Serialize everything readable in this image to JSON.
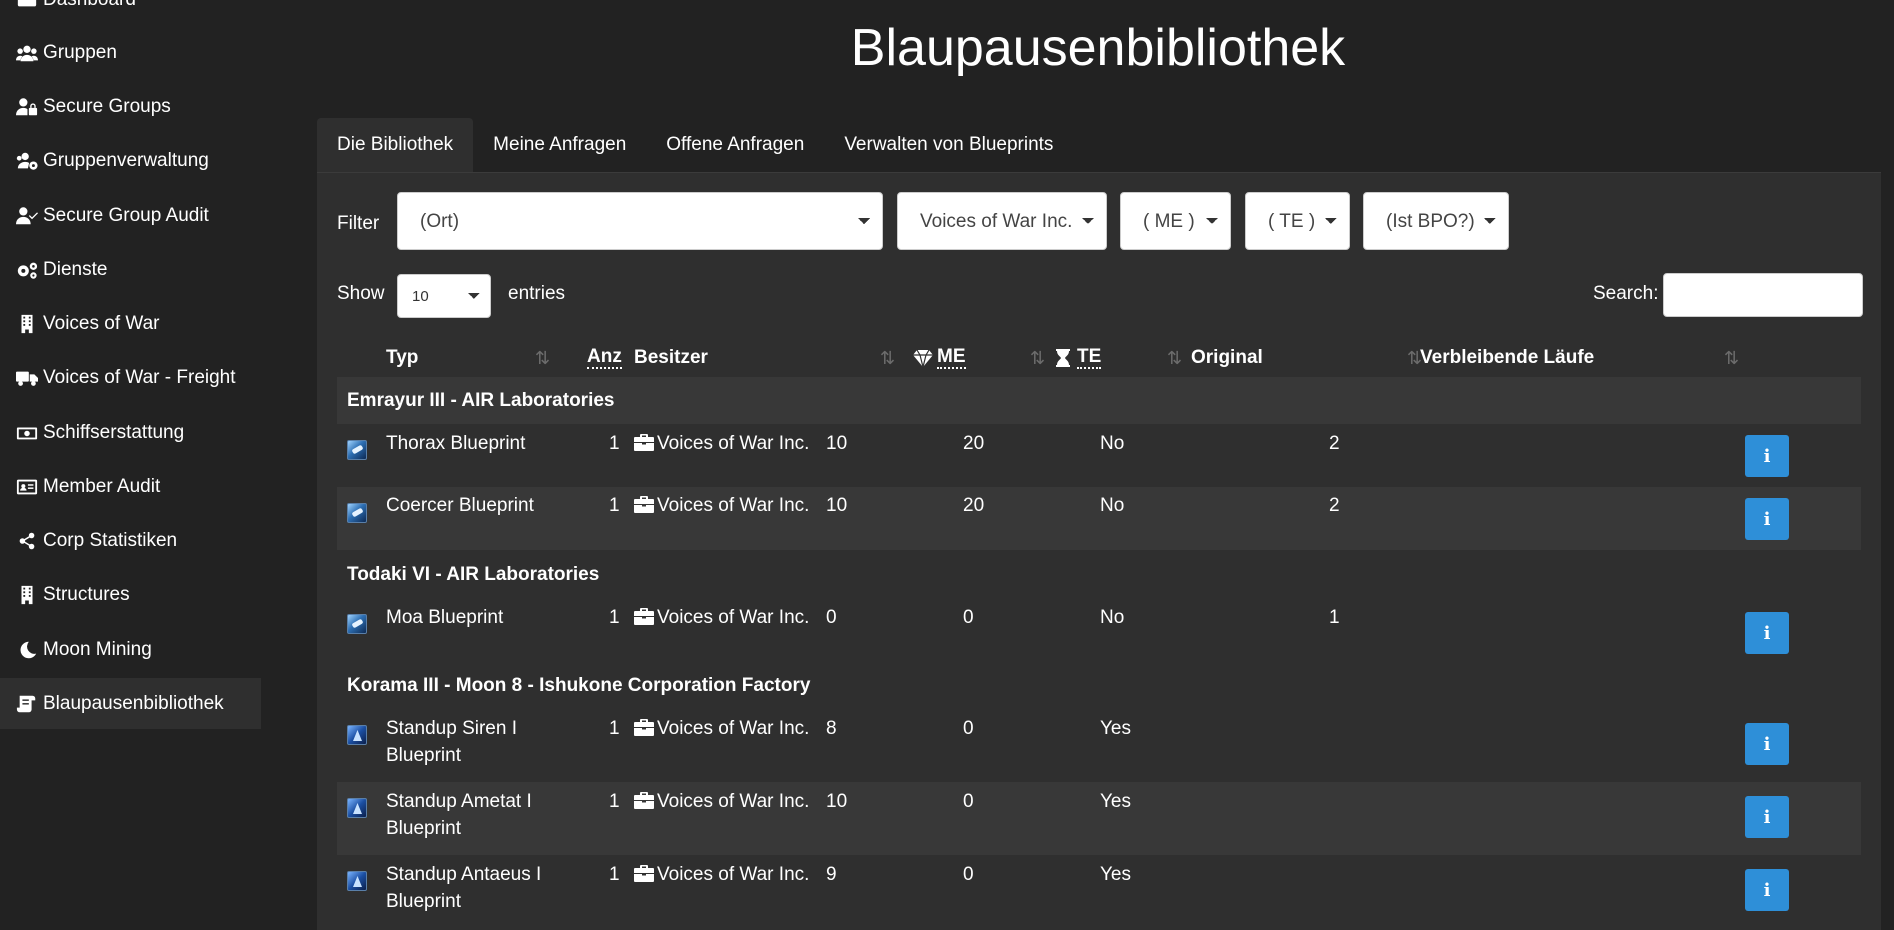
{
  "sidebar": {
    "items": [
      {
        "label": "Dashboard",
        "icon": "dashboard-icon"
      },
      {
        "label": "Gruppen",
        "icon": "users-icon"
      },
      {
        "label": "Secure Groups",
        "icon": "user-lock-icon"
      },
      {
        "label": "Gruppenverwaltung",
        "icon": "users-cog-icon"
      },
      {
        "label": "Secure Group Audit",
        "icon": "user-check-icon"
      },
      {
        "label": "Dienste",
        "icon": "cogs-icon"
      },
      {
        "label": "Voices of War",
        "icon": "building-icon"
      },
      {
        "label": "Voices of War - Freight",
        "icon": "truck-icon"
      },
      {
        "label": "Schiffserstattung",
        "icon": "money-bill-icon"
      },
      {
        "label": "Member Audit",
        "icon": "id-card-icon"
      },
      {
        "label": "Corp Statistiken",
        "icon": "share-icon"
      },
      {
        "label": "Structures",
        "icon": "building-icon"
      },
      {
        "label": "Moon Mining",
        "icon": "moon-icon"
      },
      {
        "label": "Blaupausenbibliothek",
        "icon": "scroll-icon"
      }
    ]
  },
  "page": {
    "title": "Blaupausenbibliothek"
  },
  "tabs": [
    {
      "label": "Die Bibliothek"
    },
    {
      "label": "Meine Anfragen"
    },
    {
      "label": "Offene Anfragen"
    },
    {
      "label": "Verwalten von Blueprints"
    }
  ],
  "filter": {
    "label": "Filter",
    "location": "(Ort)",
    "owner": "Voices of War Inc.",
    "me": "( ME )",
    "te": "( TE )",
    "bpo": "(Ist BPO?)"
  },
  "length": {
    "show": "Show",
    "value": "10",
    "entries": "entries"
  },
  "search": {
    "label": "Search:",
    "value": ""
  },
  "table": {
    "headers": {
      "typ": "Typ",
      "anz": "Anz",
      "besitzer": "Besitzer",
      "me": "ME",
      "te": "TE",
      "original": "Original",
      "runs": "Verbleibende Läufe"
    },
    "sort_glyph": "⇅",
    "info_glyph": "i",
    "groups": [
      {
        "location": "Emrayur III - AIR Laboratories"
      },
      {
        "location": "Todaki VI - AIR Laboratories"
      },
      {
        "location": "Korama III - Moon 8 - Ishukone Corporation Factory"
      }
    ],
    "rows": [
      {
        "type_line1": "Thorax Blueprint",
        "type_line2": "",
        "anz": "1",
        "owner": "Voices of War Inc.",
        "me": "10",
        "te": "20",
        "original": "No",
        "runs": "2"
      },
      {
        "type_line1": "Coercer Blueprint",
        "type_line2": "",
        "anz": "1",
        "owner": "Voices of War Inc.",
        "me": "10",
        "te": "20",
        "original": "No",
        "runs": "2"
      },
      {
        "type_line1": "Moa Blueprint",
        "type_line2": "",
        "anz": "1",
        "owner": "Voices of War Inc.",
        "me": "0",
        "te": "0",
        "original": "No",
        "runs": "1"
      },
      {
        "type_line1": "Standup Siren I",
        "type_line2": "Blueprint",
        "anz": "1",
        "owner": "Voices of War Inc.",
        "me": "8",
        "te": "0",
        "original": "Yes",
        "runs": ""
      },
      {
        "type_line1": "Standup Ametat I",
        "type_line2": "Blueprint",
        "anz": "1",
        "owner": "Voices of War Inc.",
        "me": "10",
        "te": "0",
        "original": "Yes",
        "runs": ""
      },
      {
        "type_line1": "Standup Antaeus I",
        "type_line2": "Blueprint",
        "anz": "1",
        "owner": "Voices of War Inc.",
        "me": "9",
        "te": "0",
        "original": "Yes",
        "runs": ""
      }
    ]
  }
}
